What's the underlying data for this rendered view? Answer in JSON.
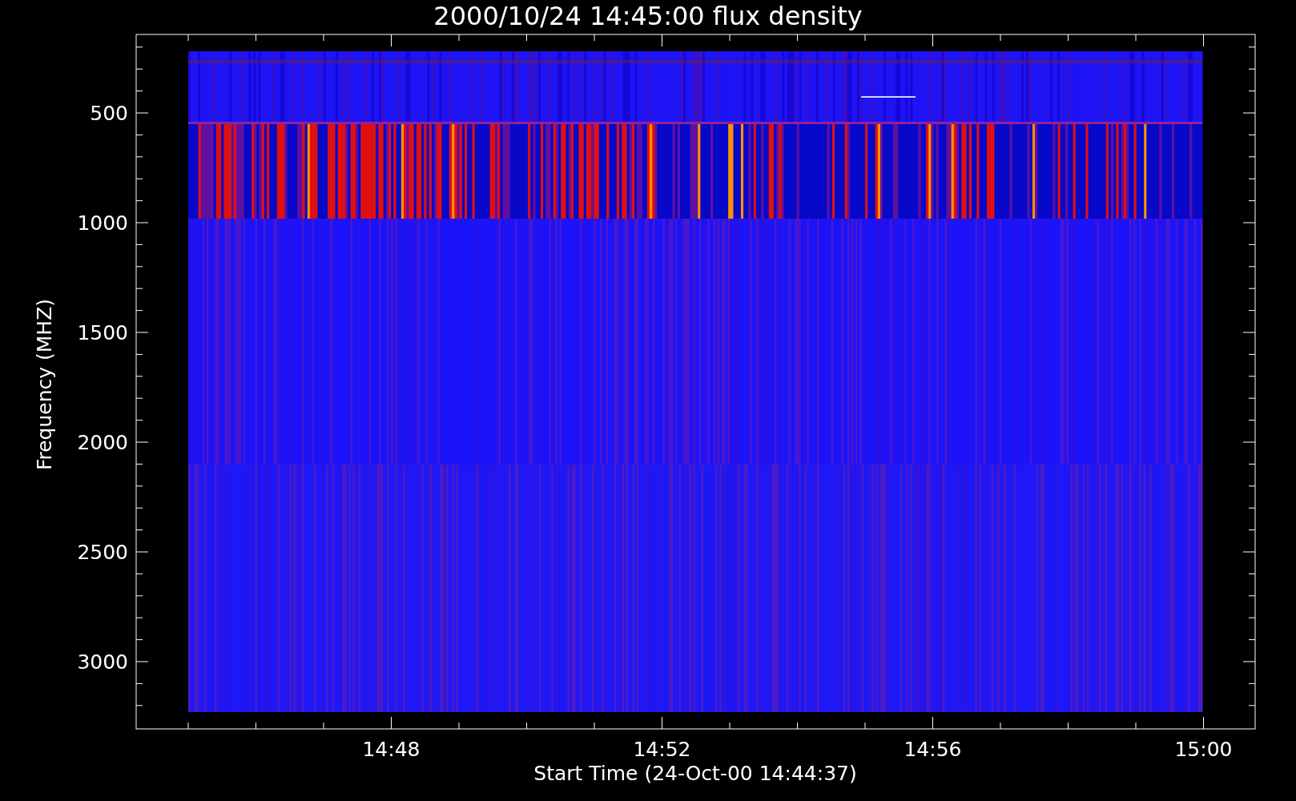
{
  "title": "2000/10/24 14:45:00 flux density",
  "y_axis": {
    "label": "Frequency (MHZ)",
    "ticks": [
      "500",
      "1000",
      "1500",
      "2000",
      "2500",
      "3000"
    ]
  },
  "x_axis": {
    "label": "Start Time (24-Oct-00 14:44:37)",
    "ticks": [
      "14:48",
      "14:52",
      "14:56",
      "15:00"
    ]
  }
}
